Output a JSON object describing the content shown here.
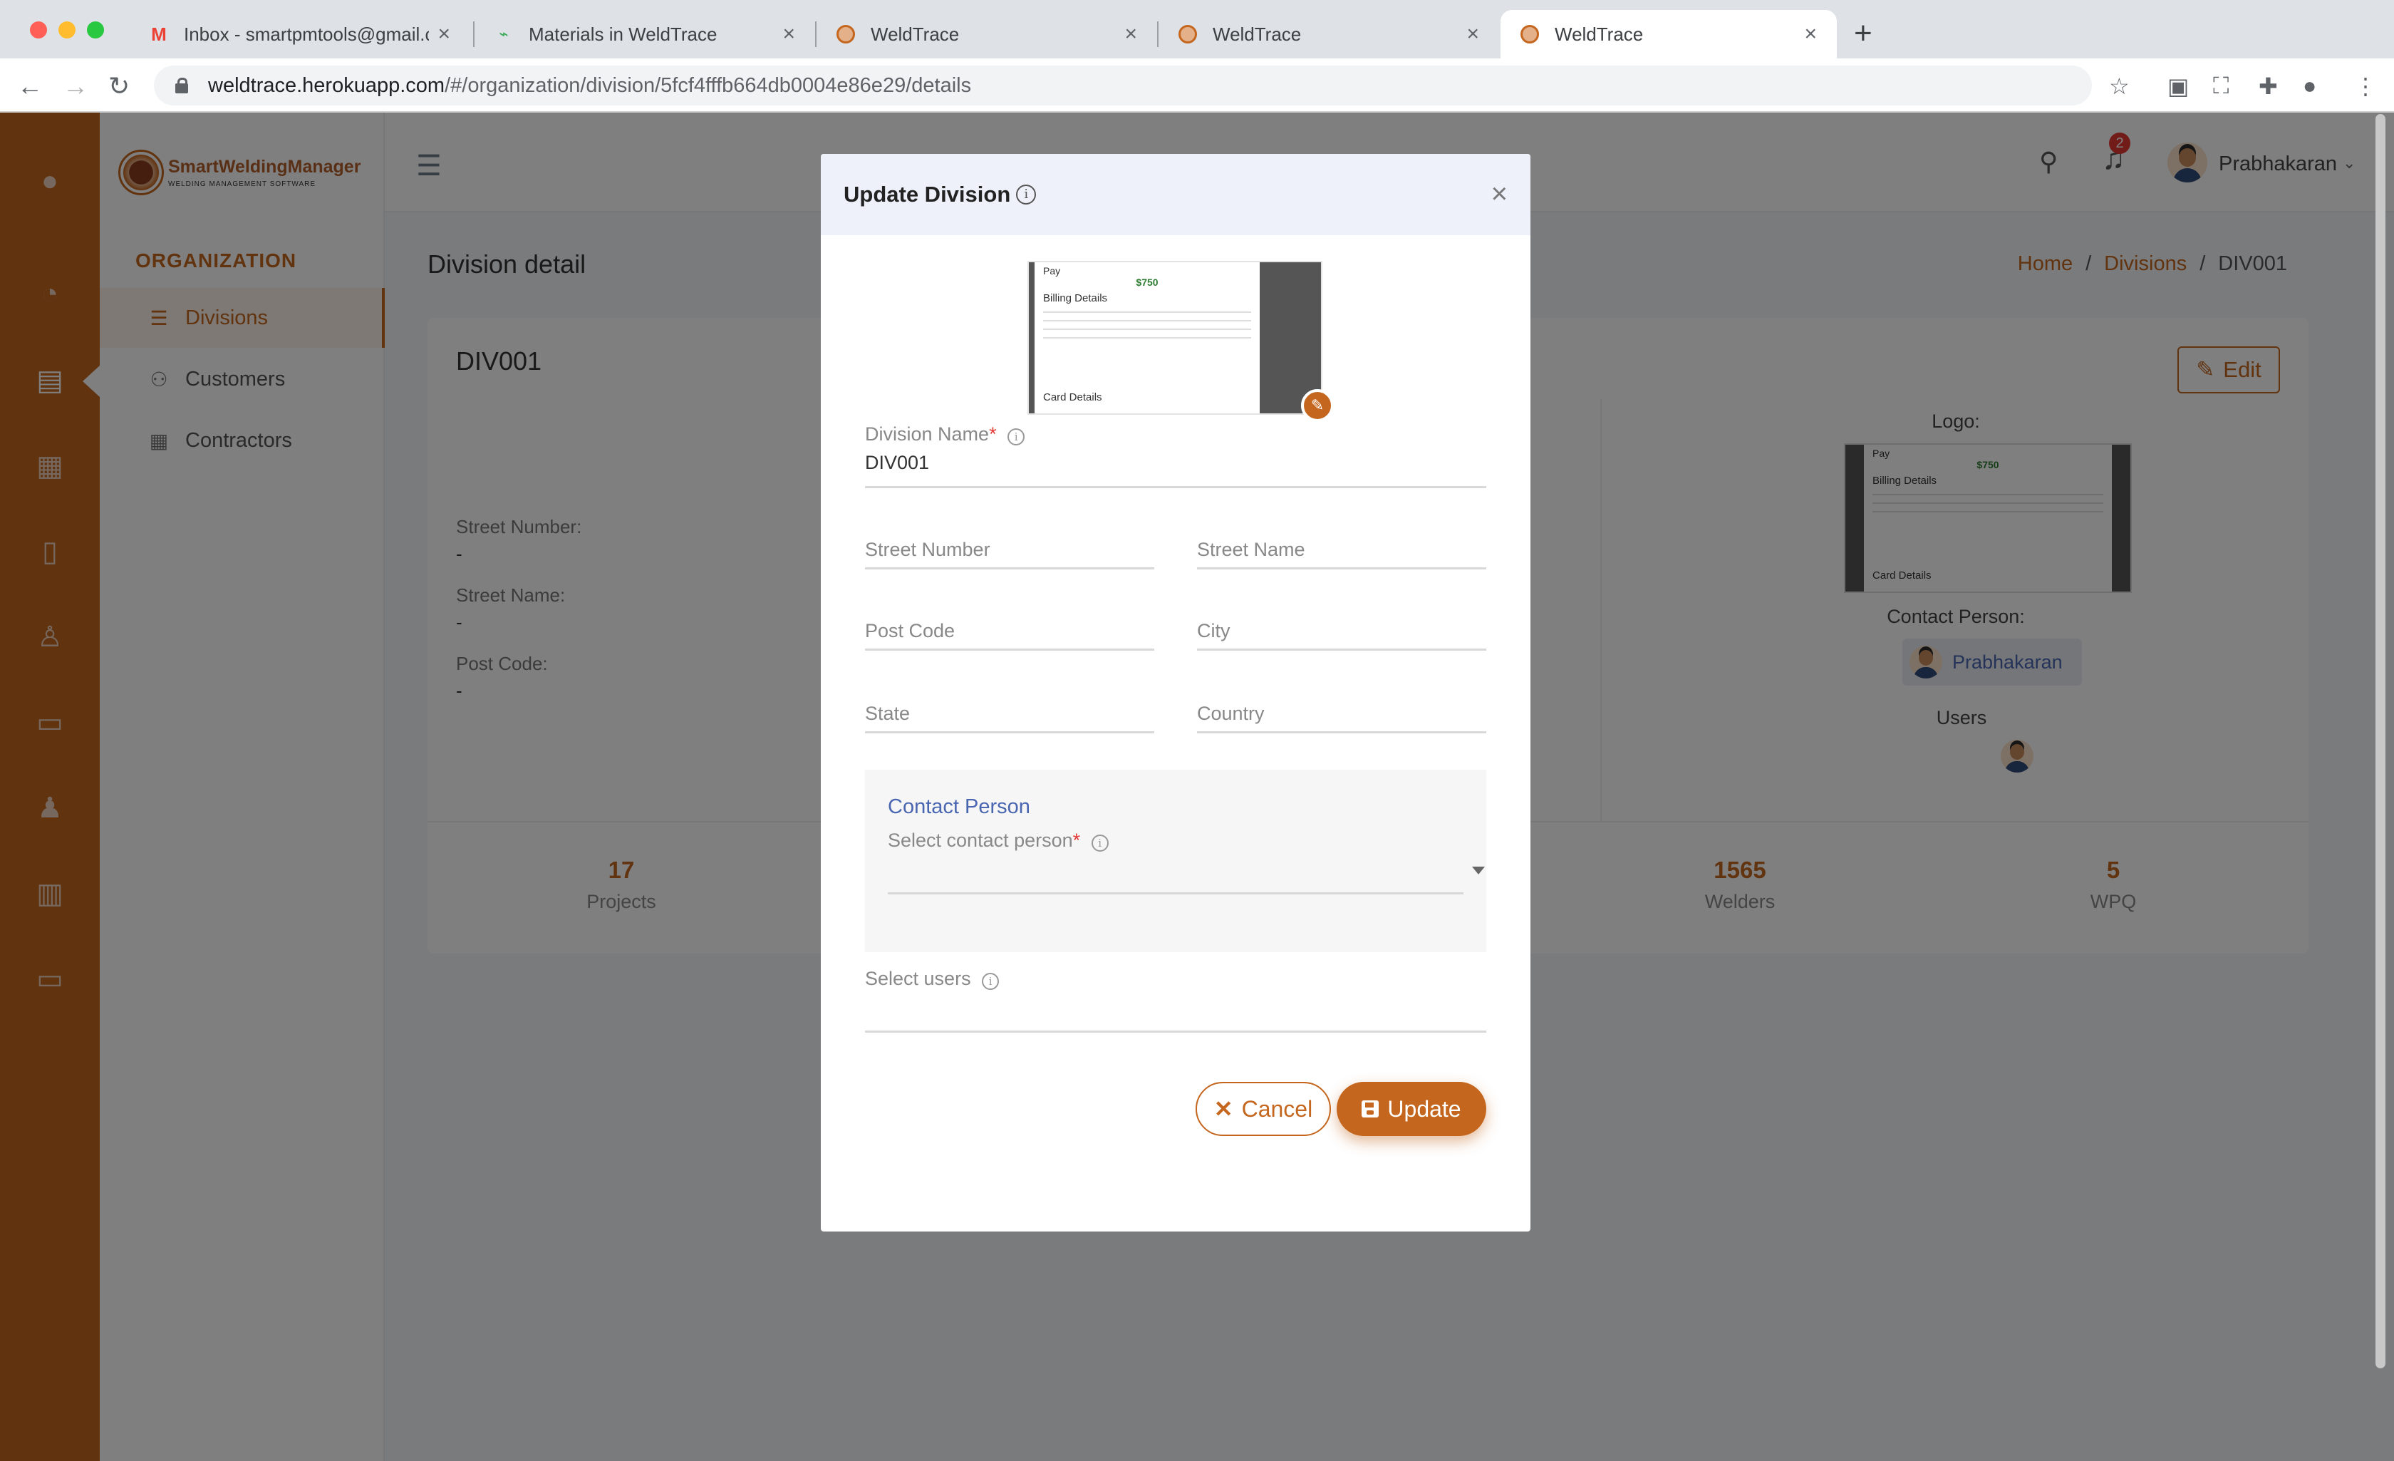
{
  "browser": {
    "tabs": [
      {
        "title": "Inbox - smartpmtools@gmail.c",
        "favicon": "gmail-icon"
      },
      {
        "title": "Materials in WeldTrace",
        "favicon": "weldtrace-leaf-icon"
      },
      {
        "title": "WeldTrace",
        "favicon": "weldtrace-icon"
      },
      {
        "title": "WeldTrace",
        "favicon": "weldtrace-icon"
      },
      {
        "title": "WeldTrace",
        "favicon": "weldtrace-icon"
      }
    ],
    "active_tab": 4,
    "url_host": "weldtrace.herokuapp.com",
    "url_path": "/#/organization/division/5fcf4fffb664db0004e86e29/details"
  },
  "brand": {
    "name": "SmartWeldingManager",
    "tagline": "WELDING MANAGEMENT SOFTWARE"
  },
  "sidebar": {
    "section_title": "ORGANIZATION",
    "items": [
      {
        "label": "Divisions",
        "icon": "list-icon",
        "active": true
      },
      {
        "label": "Customers",
        "icon": "users-icon",
        "active": false
      },
      {
        "label": "Contractors",
        "icon": "calendar-icon",
        "active": false
      }
    ]
  },
  "topbar": {
    "notification_count": "2",
    "user_name": "Prabhakaran"
  },
  "page": {
    "title": "Division detail",
    "breadcrumb": {
      "home": "Home",
      "divisions": "Divisions",
      "current": "DIV001",
      "sep": "/"
    }
  },
  "detail": {
    "code": "DIV001",
    "edit_label": "Edit",
    "fields": [
      {
        "label": "Street Number:",
        "value": "-"
      },
      {
        "label": "Street Name:",
        "value": "-"
      },
      {
        "label": "Post Code:",
        "value": "-"
      }
    ],
    "logo_label": "Logo:",
    "contact_label": "Contact Person:",
    "contact_name": "Prabhakaran",
    "users_label": "Users",
    "stats": [
      {
        "value": "17",
        "label": "Projects"
      },
      {
        "value": "1565",
        "label": "Welders"
      },
      {
        "value": "5",
        "label": "WPQ"
      }
    ]
  },
  "logo_thumbnail": {
    "pay": "Pay",
    "amount": "$750",
    "billing": "Billing Details",
    "card": "Card Details"
  },
  "modal": {
    "title": "Update Division",
    "close_symbol": "×",
    "division_name_label": "Division Name",
    "division_name_value": "DIV001",
    "required_mark": "*",
    "street_number_placeholder": "Street Number",
    "street_name_placeholder": "Street Name",
    "post_code_placeholder": "Post Code",
    "city_placeholder": "City",
    "state_placeholder": "State",
    "country_placeholder": "Country",
    "contact_section_title": "Contact Person",
    "contact_select_label": "Select contact person",
    "users_select_label": "Select users",
    "cancel_label": "Cancel",
    "update_label": "Update"
  },
  "colors": {
    "accent": "#c4661e",
    "link": "#4a66b0",
    "danger": "#e53935"
  }
}
